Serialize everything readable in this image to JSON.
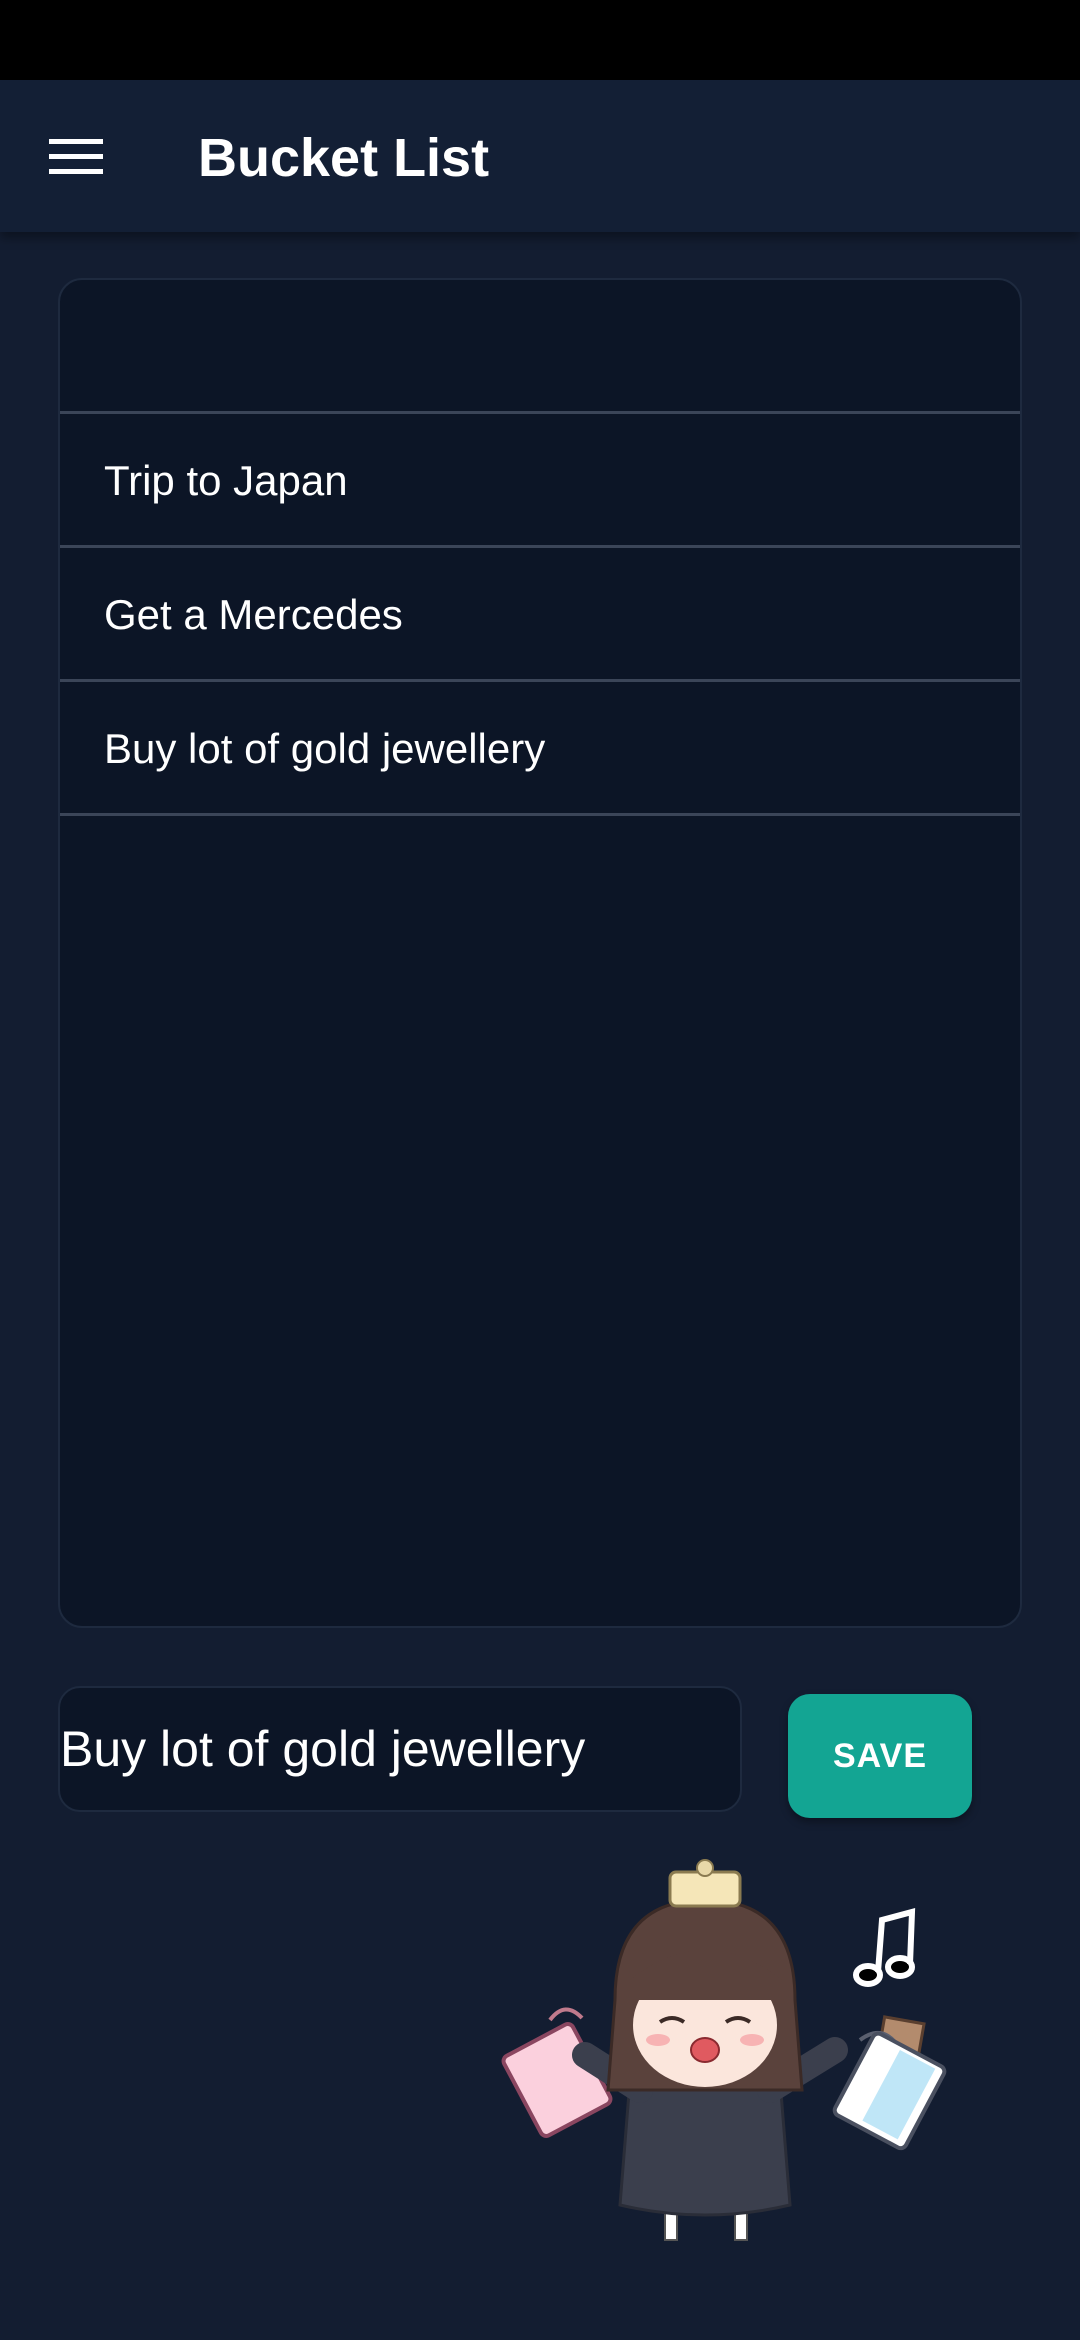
{
  "app": {
    "title": "Bucket List"
  },
  "header": {
    "menu_icon": "hamburger-menu-icon"
  },
  "list": {
    "items": [
      {
        "label": ""
      },
      {
        "label": "Trip to Japan"
      },
      {
        "label": "Get a Mercedes"
      },
      {
        "label": "Buy lot of gold jewellery"
      }
    ]
  },
  "input": {
    "value": "Buy lot of gold jewellery"
  },
  "save_button": {
    "label": "SAVE"
  },
  "colors": {
    "background": "#131d31",
    "app_bar": "#131f35",
    "card": "#0c1526",
    "accent": "#13a593",
    "text": "#ffffff"
  },
  "decoration": {
    "image": "chibi-girl-shopping-sticker"
  }
}
